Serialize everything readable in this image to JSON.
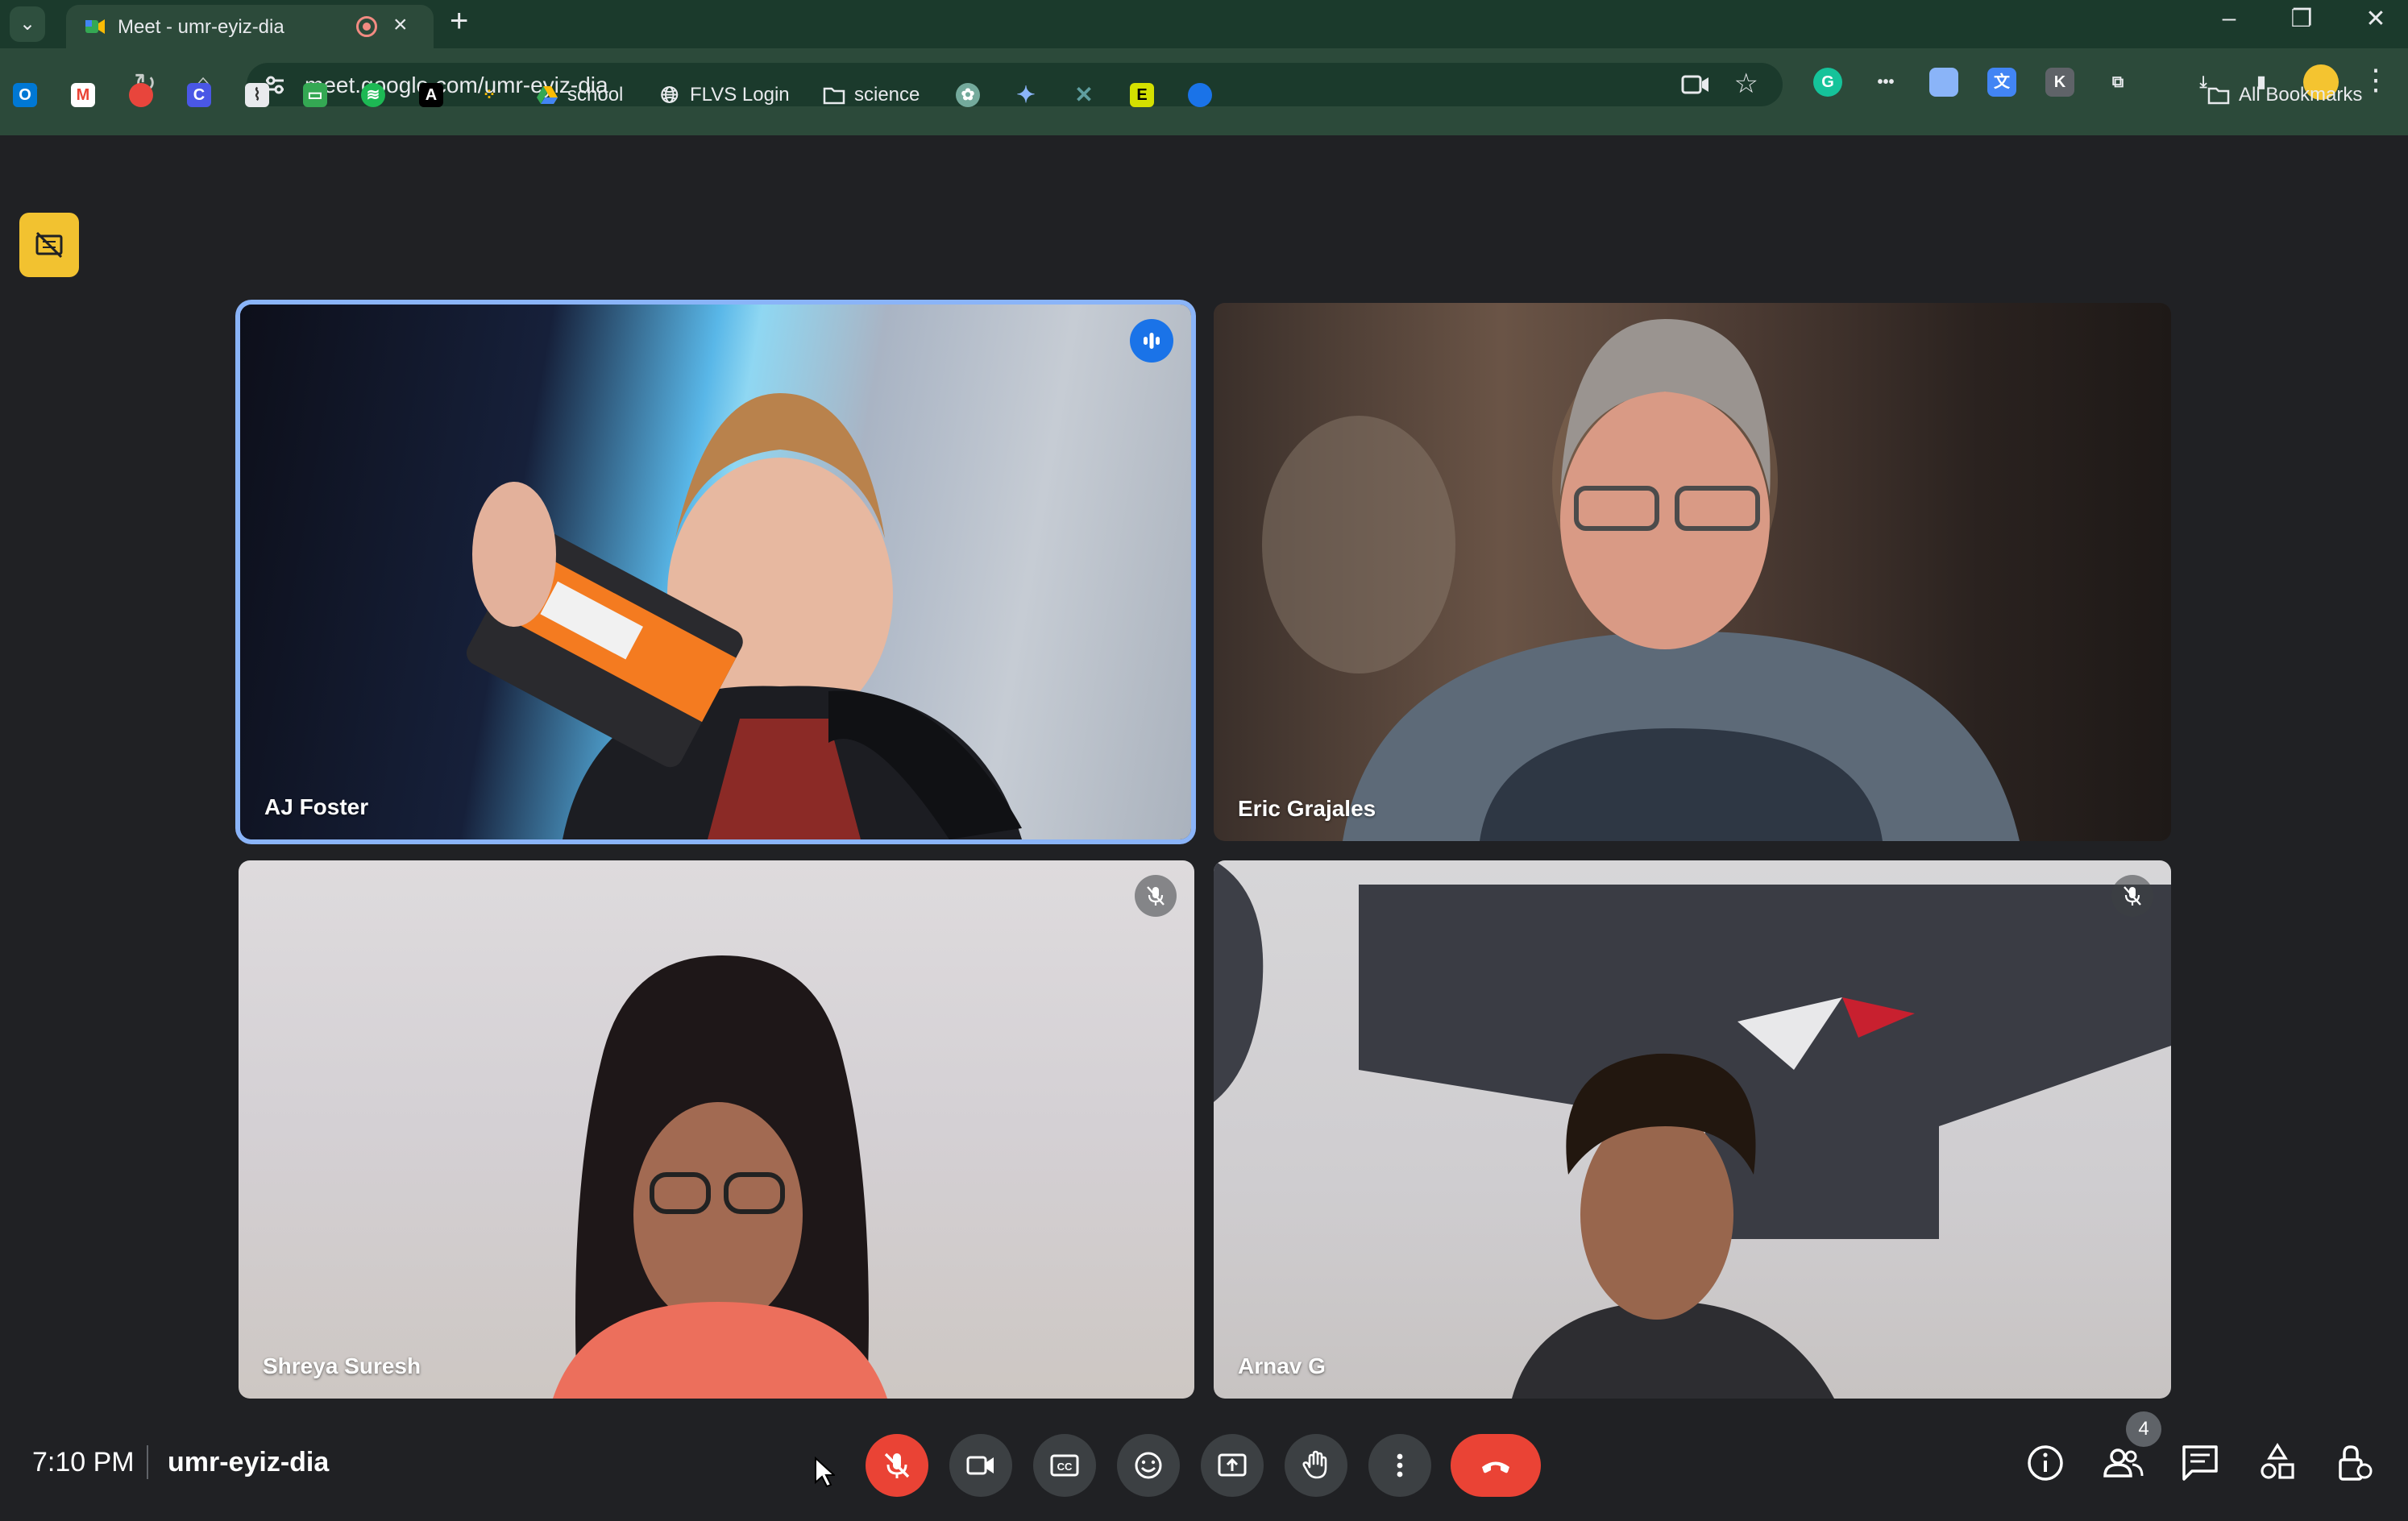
{
  "browser": {
    "tab_title": "Meet - umr-eyiz-dia",
    "url": "meet.google.com/umr-eyiz-dia",
    "bookmarks": [
      "school",
      "FLVS Login",
      "science"
    ],
    "all_bookmarks": "All Bookmarks"
  },
  "participants": [
    {
      "name": "AJ Foster",
      "state": "speaking"
    },
    {
      "name": "Eric Grajales",
      "state": "default"
    },
    {
      "name": "Shreya Suresh",
      "state": "muted"
    },
    {
      "name": "Arnav G",
      "state": "muted"
    }
  ],
  "bottom_bar": {
    "time": "7:10 PM",
    "meeting_code": "umr-eyiz-dia",
    "participant_count": "4"
  },
  "colors": {
    "tab_strip": "#1b3a2c",
    "toolbar": "#2c4a3a",
    "meet_bg": "#202124",
    "active_border": "#8ab4f8",
    "end_call": "#ea4335"
  }
}
